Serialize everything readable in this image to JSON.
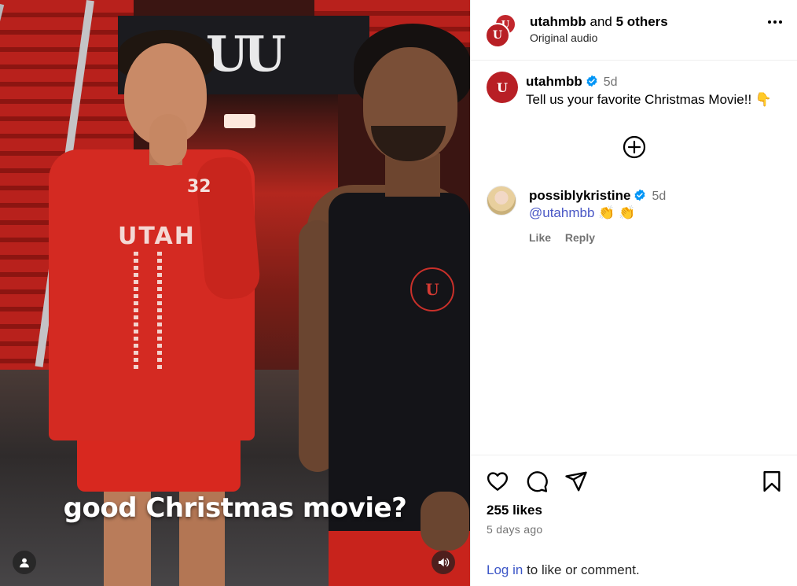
{
  "video": {
    "caption": "good Christmas movie?",
    "banner_logo": "UU",
    "jersey_text": "UTAH",
    "jersey_number": "32",
    "badge_logo": "U"
  },
  "header": {
    "username": "utahmbb",
    "and_text": "and",
    "others": "5 others",
    "audio": "Original audio",
    "avatar_label": "U"
  },
  "post": {
    "username": "utahmbb",
    "time": "5d",
    "caption": "Tell us your favorite Christmas Movie!! 👇",
    "avatar_label": "U"
  },
  "comments": [
    {
      "username": "possiblykristine",
      "time": "5d",
      "mention": "@utahmbb",
      "emojis": "👏 👏",
      "like_label": "Like",
      "reply_label": "Reply"
    }
  ],
  "footer": {
    "likes": "255 likes",
    "time_ago": "5 days ago",
    "login_link": "Log in",
    "login_rest": "to like or comment."
  },
  "colors": {
    "brand_red": "#b81f25",
    "verified_blue": "#0095f6",
    "link_blue": "#3c56c7"
  },
  "icons": [
    "heart-icon",
    "comment-icon",
    "share-icon",
    "bookmark-icon",
    "more-icon",
    "add-circle-icon",
    "user-icon",
    "volume-icon",
    "verified-icon"
  ]
}
